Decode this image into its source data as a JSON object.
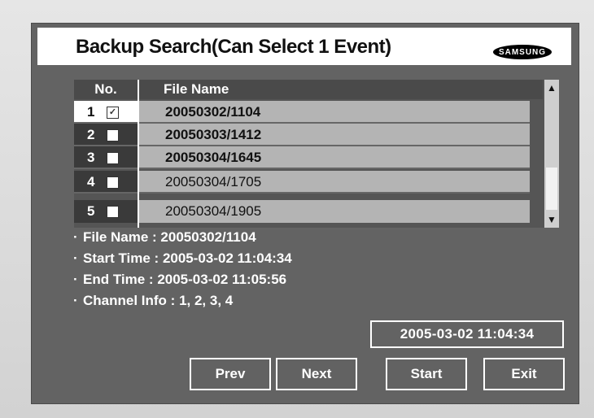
{
  "title": "Backup Search(Can Select 1 Event)",
  "logo_text": "SAMSUNG",
  "list": {
    "headers": {
      "no": "No.",
      "file_name": "File Name"
    },
    "rows": [
      {
        "no": "1",
        "checked": true,
        "file_name": "20050302/1104",
        "bold": true
      },
      {
        "no": "2",
        "checked": false,
        "file_name": "20050303/1412",
        "bold": true
      },
      {
        "no": "3",
        "checked": false,
        "file_name": "20050304/1645",
        "bold": true
      },
      {
        "no": "4",
        "checked": false,
        "file_name": "20050304/1705",
        "bold": false
      },
      {
        "no": "5",
        "checked": false,
        "file_name": "20050304/1905",
        "bold": false
      }
    ]
  },
  "info": {
    "file_name_label": "File Name",
    "file_name_value": "20050302/1104",
    "start_time_label": "Start Time",
    "start_time_value": "2005-03-02 11:04:34",
    "end_time_label": "End Time",
    "end_time_value": "2005-03-02 11:05:56",
    "channel_label": "Channel Info",
    "channel_value": "1, 2, 3, 4"
  },
  "datetime_stamp": "2005-03-02  11:04:34",
  "buttons": {
    "prev": "Prev",
    "next": "Next",
    "start": "Start",
    "exit": "Exit"
  },
  "icons": {
    "scroll_up": "triangle-up-icon",
    "scroll_down": "triangle-down-icon",
    "checkbox": "check-icon"
  }
}
